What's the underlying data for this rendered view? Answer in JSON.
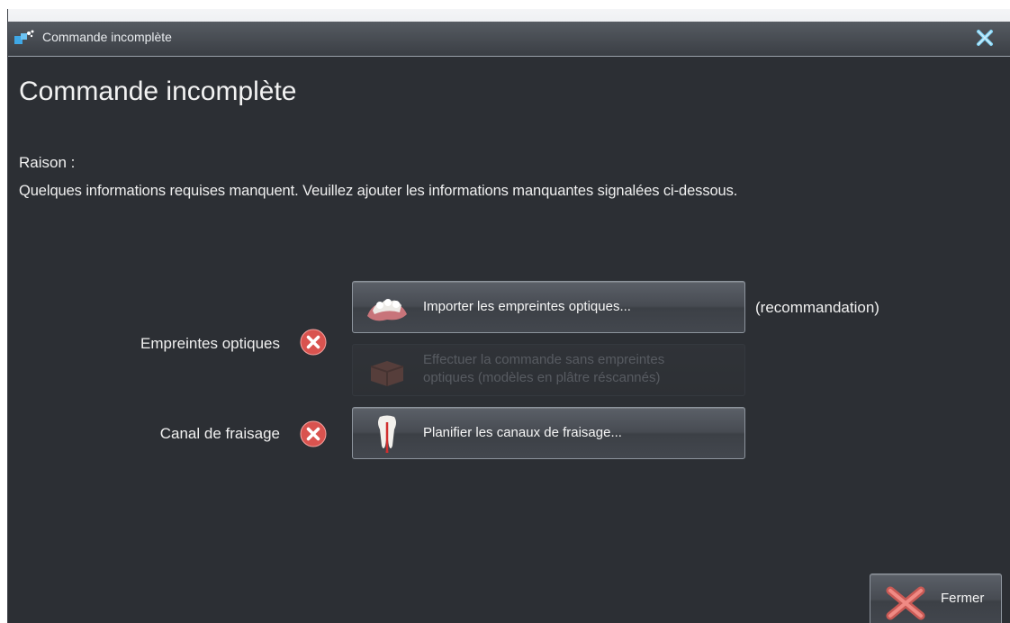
{
  "window": {
    "title": "Commande incomplète",
    "title_icon": "order-icon",
    "close_icon": "window-close-icon"
  },
  "heading": "Commande incomplète",
  "reason": {
    "label": "Raison :",
    "text": "Quelques informations requises manquent. Veuillez ajouter les informations manquantes signalées ci-dessous."
  },
  "requirements": [
    {
      "label": "Empreintes optiques",
      "status_icon": "error-x-icon",
      "actions": [
        {
          "label": "Importer les empreintes optiques...",
          "icon": "dental-impression-icon",
          "enabled": true
        },
        {
          "label_line1": "Effectuer la commande sans empreintes",
          "label_line2": "optiques (modèles en plâtre réscannés)",
          "icon": "box-icon",
          "enabled": false
        }
      ],
      "note": "(recommandation)"
    },
    {
      "label": "Canal de fraisage",
      "status_icon": "error-x-icon",
      "actions": [
        {
          "label": "Planifier les canaux de fraisage...",
          "icon": "tooth-canal-icon",
          "enabled": true
        }
      ]
    }
  ],
  "footer": {
    "close_label": "Fermer",
    "close_icon": "close-x-icon"
  },
  "colors": {
    "background": "#2c2f34",
    "error": "#d9534f",
    "text": "#f0f0f0"
  }
}
